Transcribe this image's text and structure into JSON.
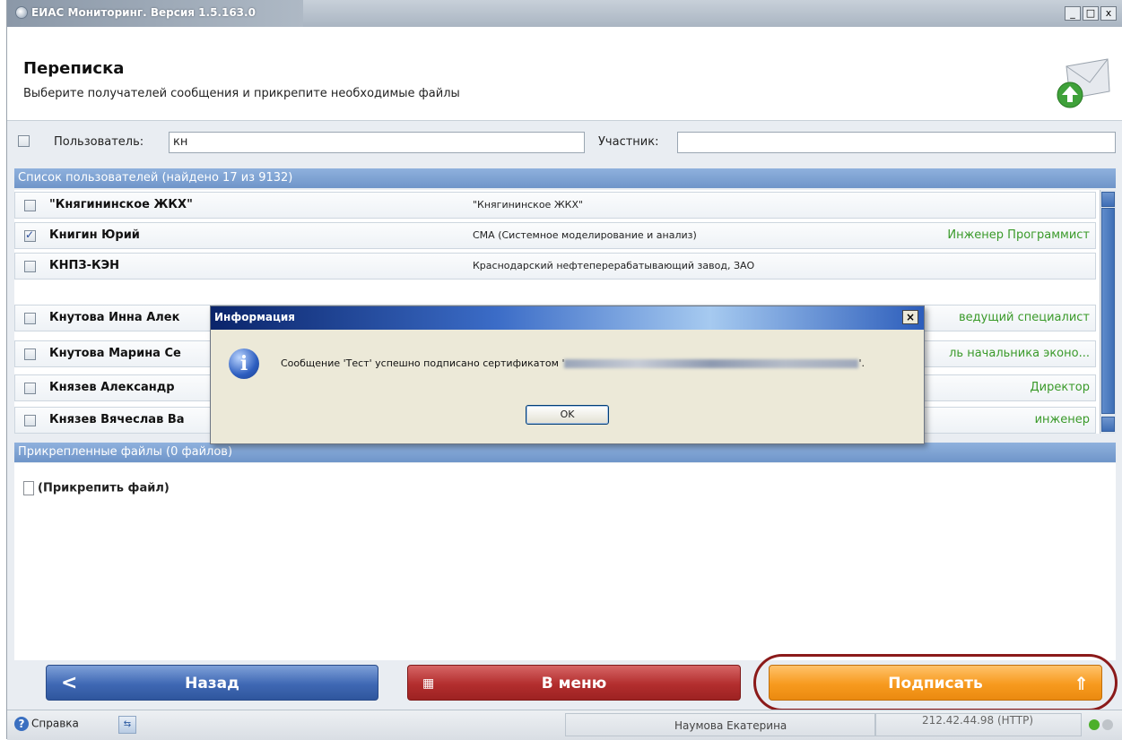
{
  "window": {
    "title": "ЕИАС Мониторинг. Версия 1.5.163.0",
    "controls": [
      "_",
      "□",
      "x"
    ]
  },
  "header": {
    "title": "Переписка",
    "subtitle": "Выберите получателей сообщения и прикрепите необходимые файлы",
    "icon": "mail-upload-icon"
  },
  "filter": {
    "user_label": "Пользователь:",
    "user_value": "кн",
    "participant_label": "Участник:",
    "participant_value": ""
  },
  "users_section": {
    "title": "Список пользователей (найдено 17 из 9132)",
    "rows": [
      {
        "checked": false,
        "name": "\"Княгининское ЖКХ\"",
        "org": "\"Княгининское ЖКХ\"",
        "position": ""
      },
      {
        "checked": true,
        "name": "Книгин Юрий",
        "org": "СМА (Системное моделирование и анализ)",
        "position": "Инженер Программист"
      },
      {
        "checked": false,
        "name": "КНПЗ-КЭН",
        "org": "Краснодарский нефтеперерабатывающий завод, ЗАО",
        "position": ""
      },
      {
        "checked": false,
        "name": "Кнутова Инна Алек",
        "org": "",
        "position": "ведущий специалист"
      },
      {
        "checked": false,
        "name": "Кнутова Марина Се",
        "org": "",
        "position": "ль начальника эконо..."
      },
      {
        "checked": false,
        "name": "Князев Александр",
        "org": "",
        "position": "Директор"
      },
      {
        "checked": false,
        "name": "Князев Вячеслав Ва",
        "org": "",
        "position": "инженер"
      }
    ]
  },
  "files_section": {
    "title": "Прикрепленные файлы (0 файлов)",
    "attach_label": "(Прикрепить файл)"
  },
  "buttons": {
    "back": "Назад",
    "menu": "В меню",
    "sign": "Подписать"
  },
  "statusbar": {
    "help": "Справка",
    "user": "Наумова Екатерина",
    "server": "212.42.44.98 (HTTP)",
    "led_colors": [
      "#4caf2a",
      "#bfc4c9"
    ]
  },
  "dialog": {
    "title": "Информация",
    "message_prefix": "Сообщение 'Тест' успешно подписано сертификатом '",
    "message_suffix": "'.",
    "ok": "OK"
  }
}
